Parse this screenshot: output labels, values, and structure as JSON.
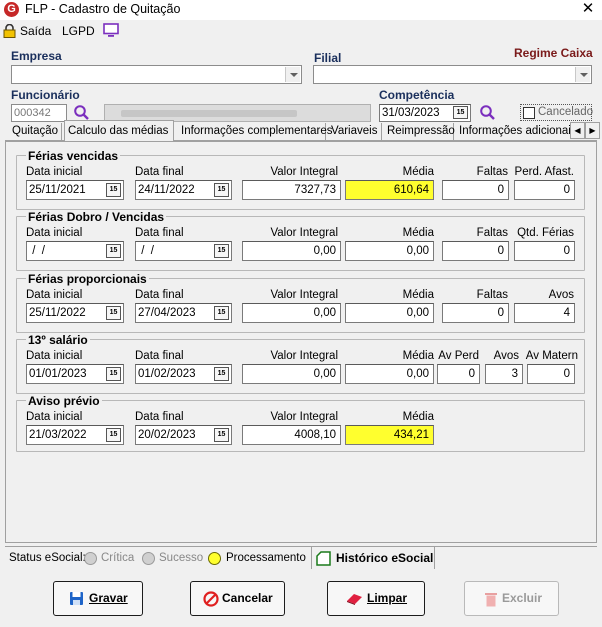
{
  "window": {
    "title": "FLP - Cadastro de Quitação",
    "close": "✕",
    "app_icon": "G"
  },
  "menu": {
    "exit": "Saída",
    "lgpd": "LGPD"
  },
  "header": {
    "empresa_label": "Empresa",
    "empresa_value": "",
    "filial_label": "Filial",
    "filial_value": "",
    "regime_label": "Regime Caixa",
    "funcionario_label": "Funcionário",
    "funcionario_code": "000342",
    "funcionario_name": "",
    "competencia_label": "Competência",
    "competencia_value": "31/03/2023",
    "cancelado_label": "Cancelado"
  },
  "tabs": [
    "Quitação",
    "Calculo das médias",
    "Informações complementares",
    "Variaveis",
    "Reimpressão",
    "Informações adicionais"
  ],
  "date_button": "15",
  "groups": {
    "ferias_vencidas": {
      "title": "Férias vencidas",
      "data_inicial_label": "Data inicial",
      "data_final_label": "Data final",
      "valor_label": "Valor Integral",
      "media_label": "Média",
      "faltas_label": "Faltas",
      "perd_label": "Perd. Afast.",
      "data_inicial": "25/11/2021",
      "data_final": "24/11/2022",
      "valor": "7327,73",
      "media": "610,64",
      "faltas": "0",
      "perd": "0"
    },
    "ferias_dobro": {
      "title": "Férias Dobro / Vencidas",
      "data_inicial_label": "Data inicial",
      "data_final_label": "Data final",
      "valor_label": "Valor Integral",
      "media_label": "Média",
      "faltas_label": "Faltas",
      "qtd_label": "Qtd. Férias",
      "data_inicial": " /  /",
      "data_final": " /  /",
      "valor": "0,00",
      "media": "0,00",
      "faltas": "0",
      "qtd": "0"
    },
    "ferias_proporcionais": {
      "title": "Férias proporcionais",
      "data_inicial_label": "Data inicial",
      "data_final_label": "Data final",
      "valor_label": "Valor Integral",
      "media_label": "Média",
      "faltas_label": "Faltas",
      "avos_label": "Avos",
      "data_inicial": "25/11/2022",
      "data_final": "27/04/2023",
      "valor": "0,00",
      "media": "0,00",
      "faltas": "0",
      "avos": "4"
    },
    "decimo_terceiro": {
      "title": "13º salário",
      "data_inicial_label": "Data inicial",
      "data_final_label": "Data final",
      "valor_label": "Valor Integral",
      "media_label": "Média",
      "av_perd_label": "Av Perd",
      "avos_label": "Avos",
      "av_matern_label": "Av Matern",
      "data_inicial": "01/01/2023",
      "data_final": "01/02/2023",
      "valor": "0,00",
      "media": "0,00",
      "av_perd": "0",
      "avos": "3",
      "av_matern": "0"
    },
    "aviso_previo": {
      "title": "Aviso prévio",
      "data_inicial_label": "Data inicial",
      "data_final_label": "Data final",
      "valor_label": "Valor Integral",
      "media_label": "Média",
      "data_inicial": "21/03/2022",
      "data_final": "20/02/2023",
      "valor": "4008,10",
      "media": "434,21"
    }
  },
  "status": {
    "label": "Status eSocial:",
    "critica": "Crítica",
    "sucesso": "Sucesso",
    "processamento": "Processamento",
    "historico": "Histórico eSocial"
  },
  "buttons": {
    "gravar": "Gravar",
    "cancelar": "Cancelar",
    "limpar": "Limpar",
    "excluir": "Excluir"
  },
  "colors": {
    "highlight": "#ffff2e",
    "label_blue": "#1a2f5c",
    "regime_red": "#7a1a1a",
    "search_purple": "#7b2fbe"
  }
}
